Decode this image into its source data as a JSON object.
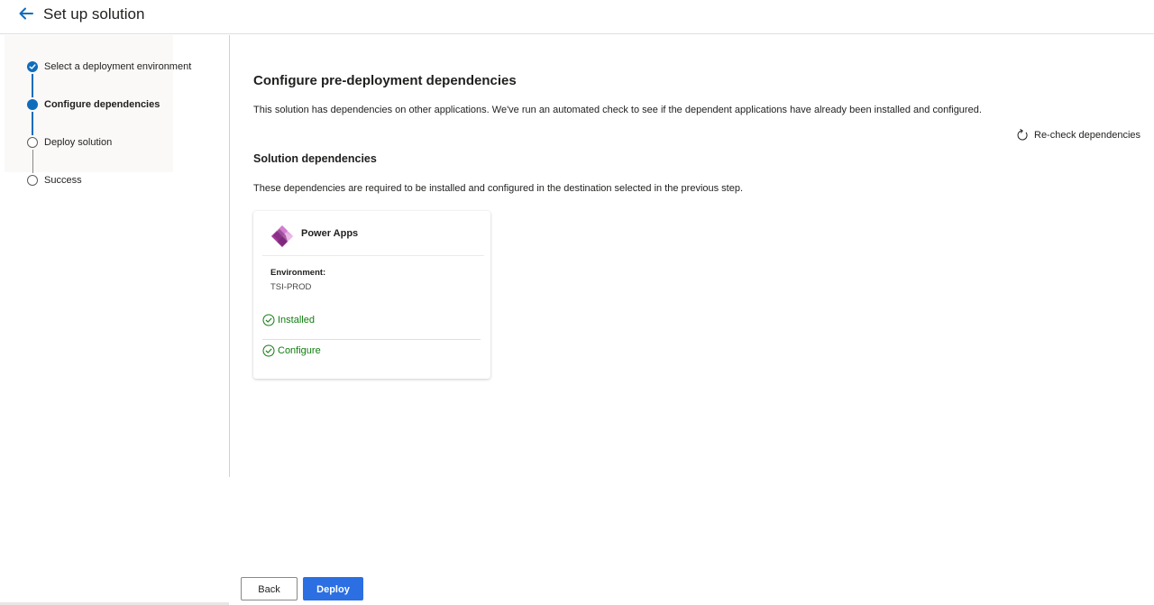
{
  "header": {
    "title": "Set up solution",
    "back_icon": "arrow-left-icon"
  },
  "colors": {
    "accent": "#0f6cbd",
    "primary_button": "#2b6fe3",
    "success": "#107c10"
  },
  "steps": [
    {
      "label": "Select a deployment environment",
      "state": "completed"
    },
    {
      "label": "Configure dependencies",
      "state": "current"
    },
    {
      "label": "Deploy solution",
      "state": "pending"
    },
    {
      "label": "Success",
      "state": "pending"
    }
  ],
  "main": {
    "title": "Configure pre-deployment dependencies",
    "description": "This solution has dependencies on other applications. We've run an automated check to see if the dependent applications have already been installed and configured.",
    "recheck_label": "Re-check dependencies",
    "recheck_icon": "refresh-icon",
    "section_title": "Solution dependencies",
    "section_description": "These dependencies are required to be installed and configured in the destination selected in the previous step."
  },
  "dependency_card": {
    "app_name": "Power Apps",
    "app_icon": "power-apps-logo",
    "environment_label": "Environment:",
    "environment_value": "TSI-PROD",
    "statuses": [
      {
        "label": "Installed",
        "icon": "check-circle-icon"
      },
      {
        "label": "Configure",
        "icon": "check-circle-icon"
      }
    ]
  },
  "footer": {
    "back_label": "Back",
    "deploy_label": "Deploy"
  }
}
